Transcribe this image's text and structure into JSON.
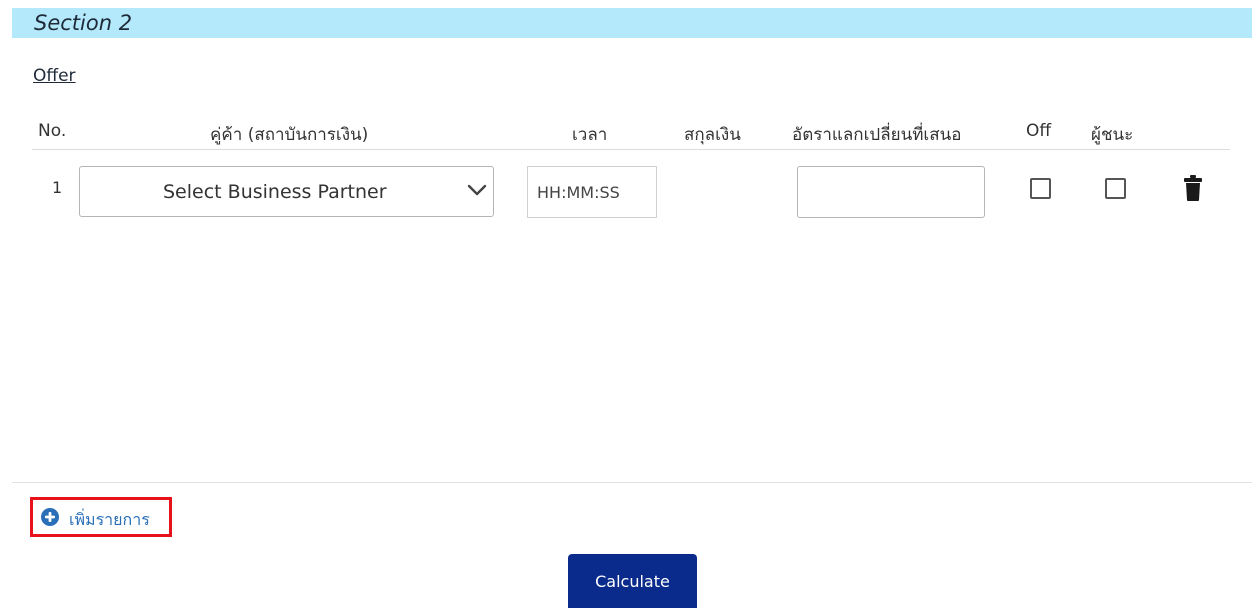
{
  "section": {
    "title": "Section 2"
  },
  "offer": {
    "title": "Offer",
    "columns": {
      "no": "No.",
      "partner": "คู่ค้า (สถาบันการเงิน)",
      "time": "เวลา",
      "currency": "สกุลเงิน",
      "rate": "อัตราแลกเปลี่ยนที่เสนอ",
      "off": "Off",
      "winner": "ผู้ชนะ"
    },
    "rows": [
      {
        "no": "1",
        "partner_placeholder": "Select Business Partner",
        "time_placeholder": "HH:MM:SS",
        "currency": "",
        "rate": "",
        "off_checked": false,
        "winner_checked": false
      }
    ]
  },
  "actions": {
    "add_item_label": "เพิ่มรายการ",
    "calculate_label": "Calculate"
  },
  "icons": {
    "dropdown": "chevron-down-icon",
    "delete": "trash-icon",
    "add": "plus-circle-icon"
  },
  "colors": {
    "section_bar": "#b3e9fb",
    "primary_button": "#0a2a8c",
    "link": "#2a6fb8",
    "highlight_border": "#e8131a"
  }
}
